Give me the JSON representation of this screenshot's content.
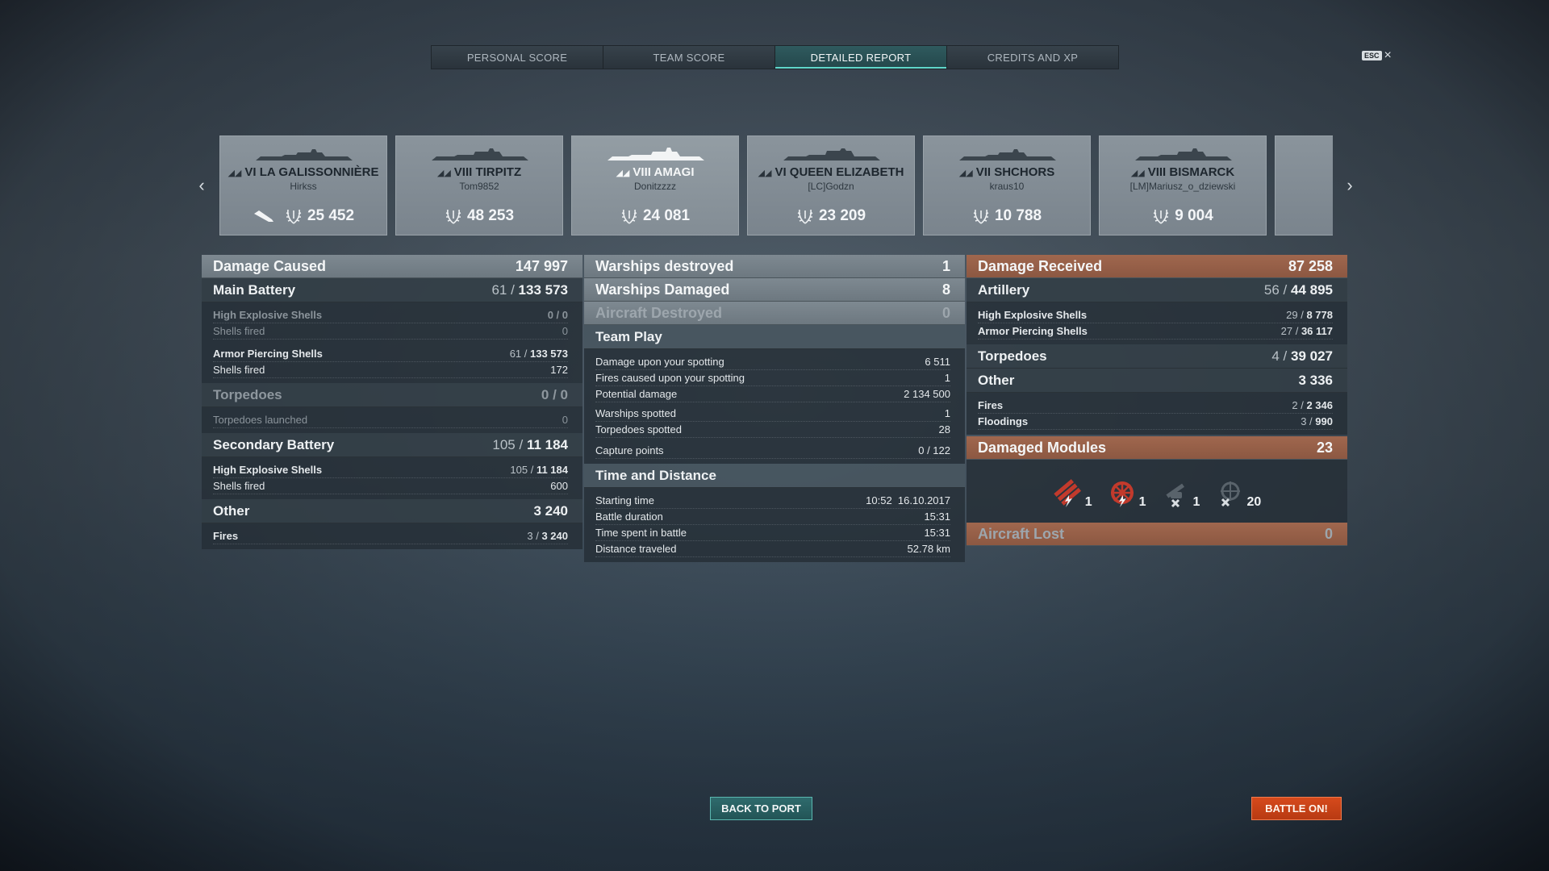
{
  "tabs": [
    {
      "label": "PERSONAL SCORE"
    },
    {
      "label": "TEAM SCORE"
    },
    {
      "label": "DETAILED REPORT"
    },
    {
      "label": "CREDITS AND XP"
    }
  ],
  "esc": {
    "key": "ESC",
    "close": "×"
  },
  "nav": {
    "prev": "‹",
    "next": "›"
  },
  "cards": [
    {
      "tier_name": "VI LA GALISSONNIÈRE",
      "player": "Hirkss",
      "score": "25 452",
      "has_plane": true
    },
    {
      "tier_name": "VIII TIRPITZ",
      "player": "Tom9852",
      "score": "48 253"
    },
    {
      "tier_name": "VIII AMAGI",
      "player": "Donitzzzz",
      "score": "24 081"
    },
    {
      "tier_name": "VI QUEEN ELIZABETH",
      "player": "[LC]Godzn",
      "score": "23 209"
    },
    {
      "tier_name": "VII SHCHORS",
      "player": "kraus10",
      "score": "10 788"
    },
    {
      "tier_name": "VIII BISMARCK",
      "player": "[LM]Mariusz_o_dziewski",
      "score": "9 004"
    }
  ],
  "left": {
    "damage_caused": {
      "label": "Damage Caused",
      "value": "147 997"
    },
    "main_battery": {
      "label": "Main Battery",
      "a": "61 /",
      "b": "133 573"
    },
    "he": {
      "label": "High Explosive Shells",
      "value": "0 / 0"
    },
    "he_fired": {
      "label": "Shells fired",
      "value": "0"
    },
    "ap": {
      "label": "Armor Piercing Shells",
      "a": "61 /",
      "b": "133 573"
    },
    "ap_fired": {
      "label": "Shells fired",
      "value": "172"
    },
    "torpedoes": {
      "label": "Torpedoes",
      "value": "0 / 0"
    },
    "torp_launched": {
      "label": "Torpedoes launched",
      "value": "0"
    },
    "secondary": {
      "label": "Secondary Battery",
      "a": "105 /",
      "b": "11 184"
    },
    "sec_he": {
      "label": "High Explosive Shells",
      "a": "105 /",
      "b": "11 184"
    },
    "sec_fired": {
      "label": "Shells fired",
      "value": "600"
    },
    "other": {
      "label": "Other",
      "value": "3 240"
    },
    "fires": {
      "label": "Fires",
      "a": "3 /",
      "b": "3 240"
    }
  },
  "middle": {
    "destroyed": {
      "label": "Warships destroyed",
      "value": "1"
    },
    "damaged": {
      "label": "Warships Damaged",
      "value": "8"
    },
    "aircraft": {
      "label": "Aircraft Destroyed",
      "value": "0"
    },
    "team_play": {
      "label": "Team Play"
    },
    "spotting_dmg": {
      "label": "Damage upon your spotting",
      "value": "6 511"
    },
    "spotting_fires": {
      "label": "Fires caused upon your spotting",
      "value": "1"
    },
    "potential": {
      "label": "Potential damage",
      "value": "2 134 500"
    },
    "warships_spotted": {
      "label": "Warships spotted",
      "value": "1"
    },
    "torps_spotted": {
      "label": "Torpedoes spotted",
      "value": "28"
    },
    "capture": {
      "label": "Capture points",
      "value": "0 / 122"
    },
    "time_distance": {
      "label": "Time and Distance"
    },
    "start": {
      "label": "Starting time",
      "value": "10:52  16.10.2017"
    },
    "duration": {
      "label": "Battle duration",
      "value": "15:31"
    },
    "in_battle": {
      "label": "Time spent in battle",
      "value": "15:31"
    },
    "distance": {
      "label": "Distance traveled",
      "value": "52.78 km"
    }
  },
  "right": {
    "received": {
      "label": "Damage Received",
      "value": "87 258"
    },
    "artillery": {
      "label": "Artillery",
      "a": "56 /",
      "b": "44 895"
    },
    "he": {
      "label": "High Explosive Shells",
      "a": "29 /",
      "b": "8 778"
    },
    "ap": {
      "label": "Armor Piercing Shells",
      "a": "27 /",
      "b": "36 117"
    },
    "torpedoes": {
      "label": "Torpedoes",
      "a": "4 /",
      "b": "39 027"
    },
    "other": {
      "label": "Other",
      "value": "3 336"
    },
    "fires": {
      "label": "Fires",
      "a": "2 /",
      "b": "2 346"
    },
    "floodings": {
      "label": "Floodings",
      "a": "3 /",
      "b": "990"
    },
    "modules": {
      "label": "Damaged Modules",
      "value": "23"
    },
    "module_items": [
      {
        "icon": "torpedo-tubes-icon",
        "count": "1"
      },
      {
        "icon": "steering-gear-icon",
        "count": "1"
      },
      {
        "icon": "main-gun-icon",
        "count": "1"
      },
      {
        "icon": "secondary-gun-icon",
        "count": "20"
      }
    ],
    "aircraft_lost": {
      "label": "Aircraft Lost",
      "value": "0"
    }
  },
  "buttons": {
    "port": "BACK TO PORT",
    "battle": "BATTLE ON!"
  }
}
